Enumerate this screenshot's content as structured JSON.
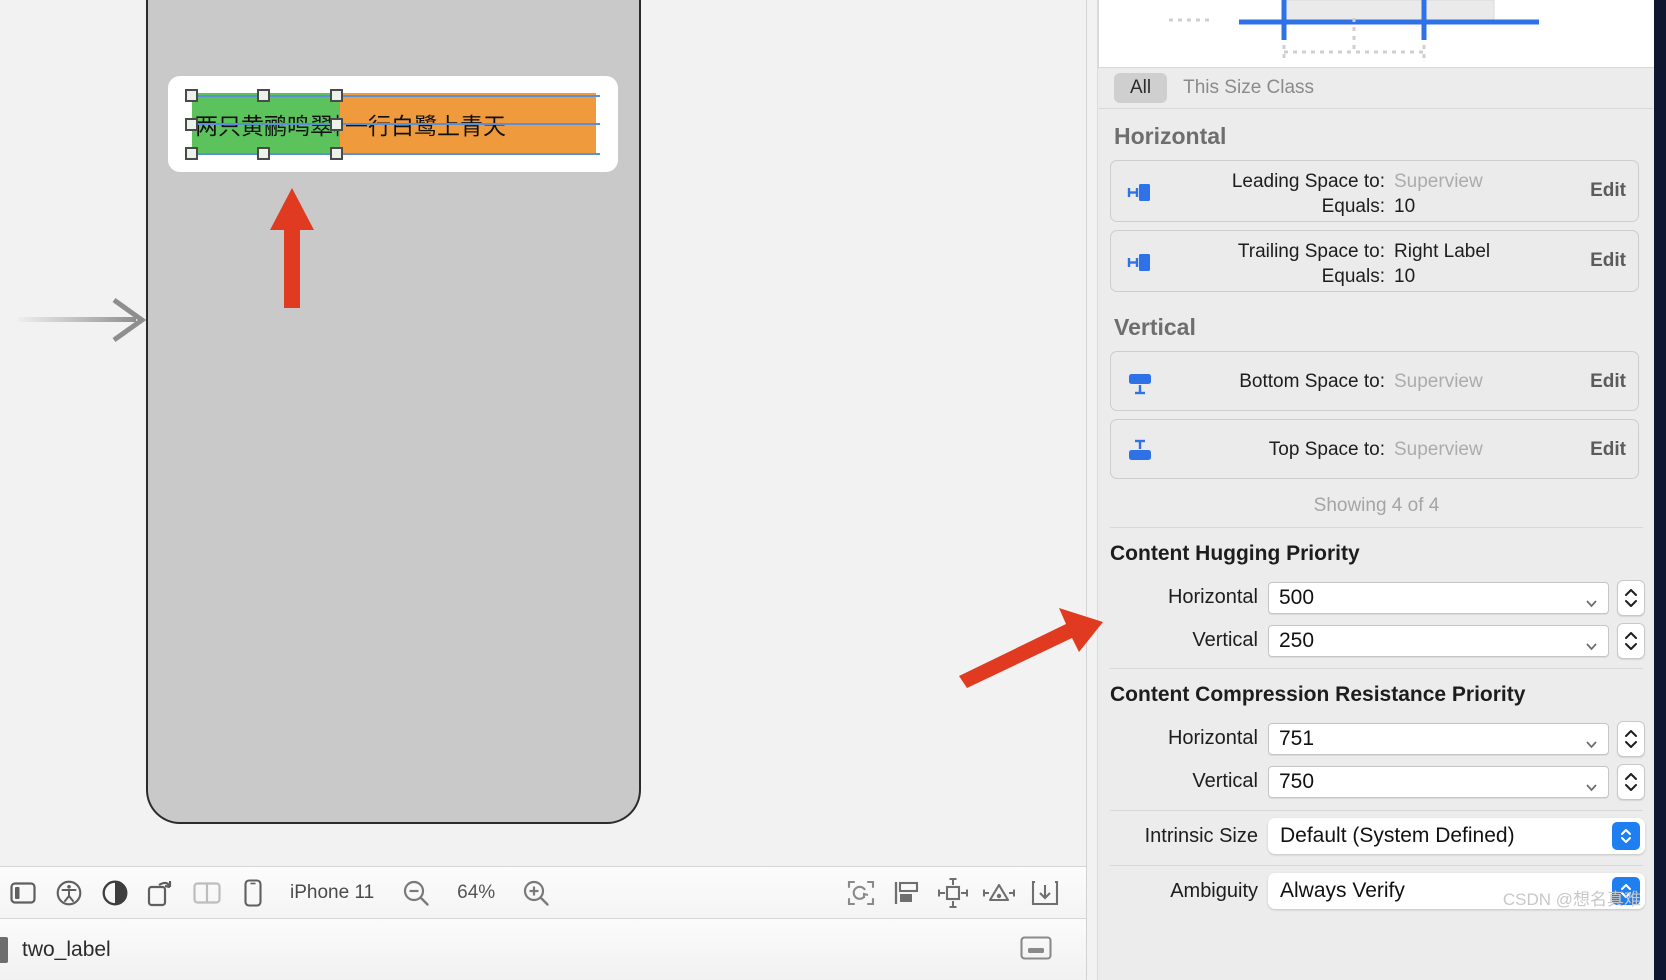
{
  "canvas": {
    "labels": [
      {
        "text": "两只黄鹂鸣翠柳",
        "color": "#5cc35c",
        "name": "left-label"
      },
      {
        "text": "一行白鹭上青天",
        "color": "#ef9a3c",
        "name": "right-label"
      }
    ]
  },
  "toolbar": {
    "icons": [
      "sidebar-toggle-icon",
      "accessibility-icon",
      "appearance-contrast-icon",
      "orientation-rotate-icon",
      "assistant-editor-icon",
      "device-bezel-icon"
    ],
    "device_name": "iPhone 11",
    "zoom_out_label": "zoom-out-icon",
    "zoom_value": "64%",
    "zoom_in_label": "zoom-in-icon",
    "right_icons": [
      "update-frames-icon",
      "embed-in-stack-icon",
      "add-new-constraints-icon",
      "resolve-auto-layout-issues-icon",
      "add-editor-icon"
    ]
  },
  "status_bar": {
    "label": "two_label"
  },
  "inspector": {
    "size_class": {
      "all_label": "All",
      "this_size_class_label": "This Size Class"
    },
    "horizontal": {
      "title": "Horizontal",
      "constraints": [
        {
          "icon": "leading-space-icon",
          "relation_label": "Leading Space to:",
          "relation_value": "Superview",
          "relation_value_muted": true,
          "equals_label": "Equals:",
          "equals_value": "10",
          "edit_label": "Edit"
        },
        {
          "icon": "trailing-space-icon",
          "relation_label": "Trailing Space to:",
          "relation_value": "Right Label",
          "relation_value_muted": false,
          "equals_label": "Equals:",
          "equals_value": "10",
          "edit_label": "Edit"
        }
      ]
    },
    "vertical": {
      "title": "Vertical",
      "constraints": [
        {
          "icon": "bottom-space-icon",
          "relation_label": "Bottom Space to:",
          "relation_value": "Superview",
          "relation_value_muted": true,
          "equals_label": "",
          "equals_value": "",
          "edit_label": "Edit"
        },
        {
          "icon": "top-space-icon",
          "relation_label": "Top Space to:",
          "relation_value": "Superview",
          "relation_value_muted": true,
          "equals_label": "",
          "equals_value": "",
          "edit_label": "Edit"
        }
      ]
    },
    "showing_text": "Showing 4 of 4",
    "content_hugging": {
      "title": "Content Hugging Priority",
      "horizontal_label": "Horizontal",
      "horizontal_value": "500",
      "vertical_label": "Vertical",
      "vertical_value": "250"
    },
    "compression_resistance": {
      "title": "Content Compression Resistance Priority",
      "horizontal_label": "Horizontal",
      "horizontal_value": "751",
      "vertical_label": "Vertical",
      "vertical_value": "750"
    },
    "intrinsic_size": {
      "label": "Intrinsic Size",
      "value": "Default (System Defined)"
    },
    "ambiguity": {
      "label": "Ambiguity",
      "value": "Always Verify"
    }
  },
  "watermark": "CSDN @想名真难",
  "colors": {
    "accent_blue": "#1f7ef0",
    "constraint_blue": "#5b8fd6",
    "annotation_red": "#e03a20",
    "panel_bg": "#ececec"
  }
}
